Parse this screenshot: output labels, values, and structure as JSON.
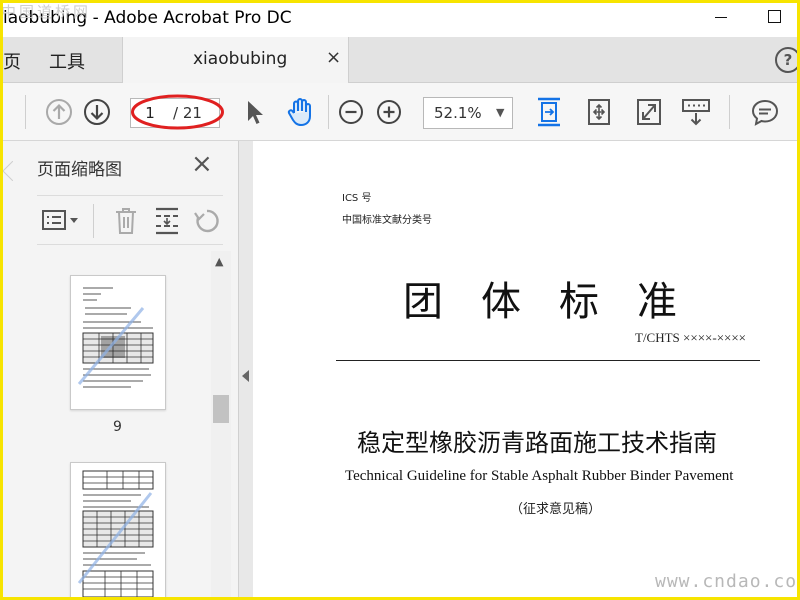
{
  "window": {
    "title": "iaobubing - Adobe Acrobat Pro DC",
    "site_watermark_top": "中国道桥网"
  },
  "tabs": {
    "home_label": "页",
    "tools_label": "工具",
    "document_tab_label": "xiaobubing",
    "document_tab_close": "×",
    "help_label": "?"
  },
  "toolbar": {
    "icons": [
      "arrow-up-circle-icon",
      "arrow-down-circle-icon",
      "select-cursor-icon",
      "hand-icon",
      "zoom-out-icon",
      "zoom-in-icon",
      "fit-page-icon",
      "rotate-fit-icon",
      "fullscreen-icon",
      "scroll-mode-icon",
      "comment-icon"
    ],
    "current_page": "1",
    "total_pages": "/ 21",
    "zoom": "52.1%",
    "accent_color": "#1473e6",
    "annotation_color": "#e02020"
  },
  "panel": {
    "title": "页面缩略图",
    "close_label": "×",
    "tool_icons": [
      "thumbnail-options-icon",
      "delete-page-icon",
      "insert-page-icon",
      "rotate-page-icon"
    ],
    "thumbnails": [
      {
        "page_label": "9"
      },
      {
        "page_label": ""
      }
    ]
  },
  "document": {
    "ics": "ICS 号",
    "classification": "中国标准文献分类号",
    "big_title": "团体标准",
    "standard_code": "T/CHTS ××××-××××",
    "cn_title": "稳定型橡胶沥青路面施工技术指南",
    "en_title": "Technical Guideline for Stable Asphalt Rubber Binder Pavement",
    "draft_note": "（征求意见稿）"
  },
  "watermark_bottom": "www.cndao.com"
}
